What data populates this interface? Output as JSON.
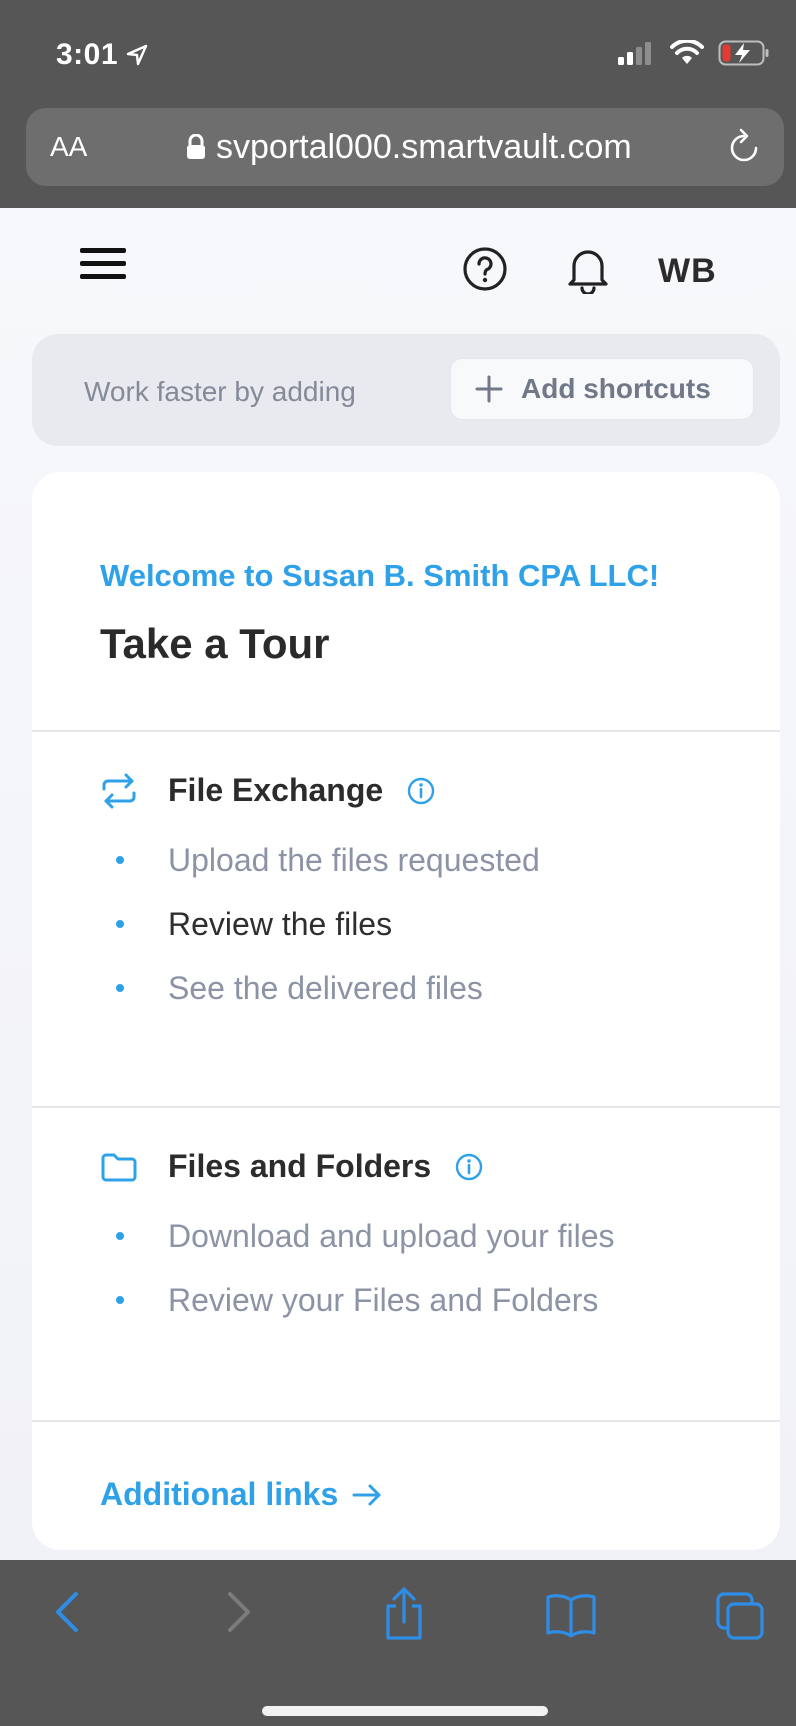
{
  "status_bar": {
    "time": "3:01"
  },
  "browser": {
    "text_size_label": "AA",
    "url": "svportal000.smartvault.com"
  },
  "header": {
    "user_initials": "WB"
  },
  "shortcuts": {
    "prompt": "Work faster by adding",
    "button_label": "Add shortcuts"
  },
  "tour": {
    "welcome": "Welcome to Susan B. Smith CPA LLC!",
    "title": "Take a Tour",
    "sections": [
      {
        "title": "File Exchange",
        "icon": "exchange-icon",
        "items": [
          "Upload the files requested",
          "Review the files",
          "See the delivered files"
        ]
      },
      {
        "title": "Files and Folders",
        "icon": "folder-icon",
        "items": [
          "Download and upload your files",
          "Review your Files and Folders"
        ]
      }
    ],
    "additional_links": "Additional links"
  },
  "colors": {
    "accent": "#2ea1e8",
    "safari_chrome": "#565656",
    "battery_low": "#e53935"
  }
}
